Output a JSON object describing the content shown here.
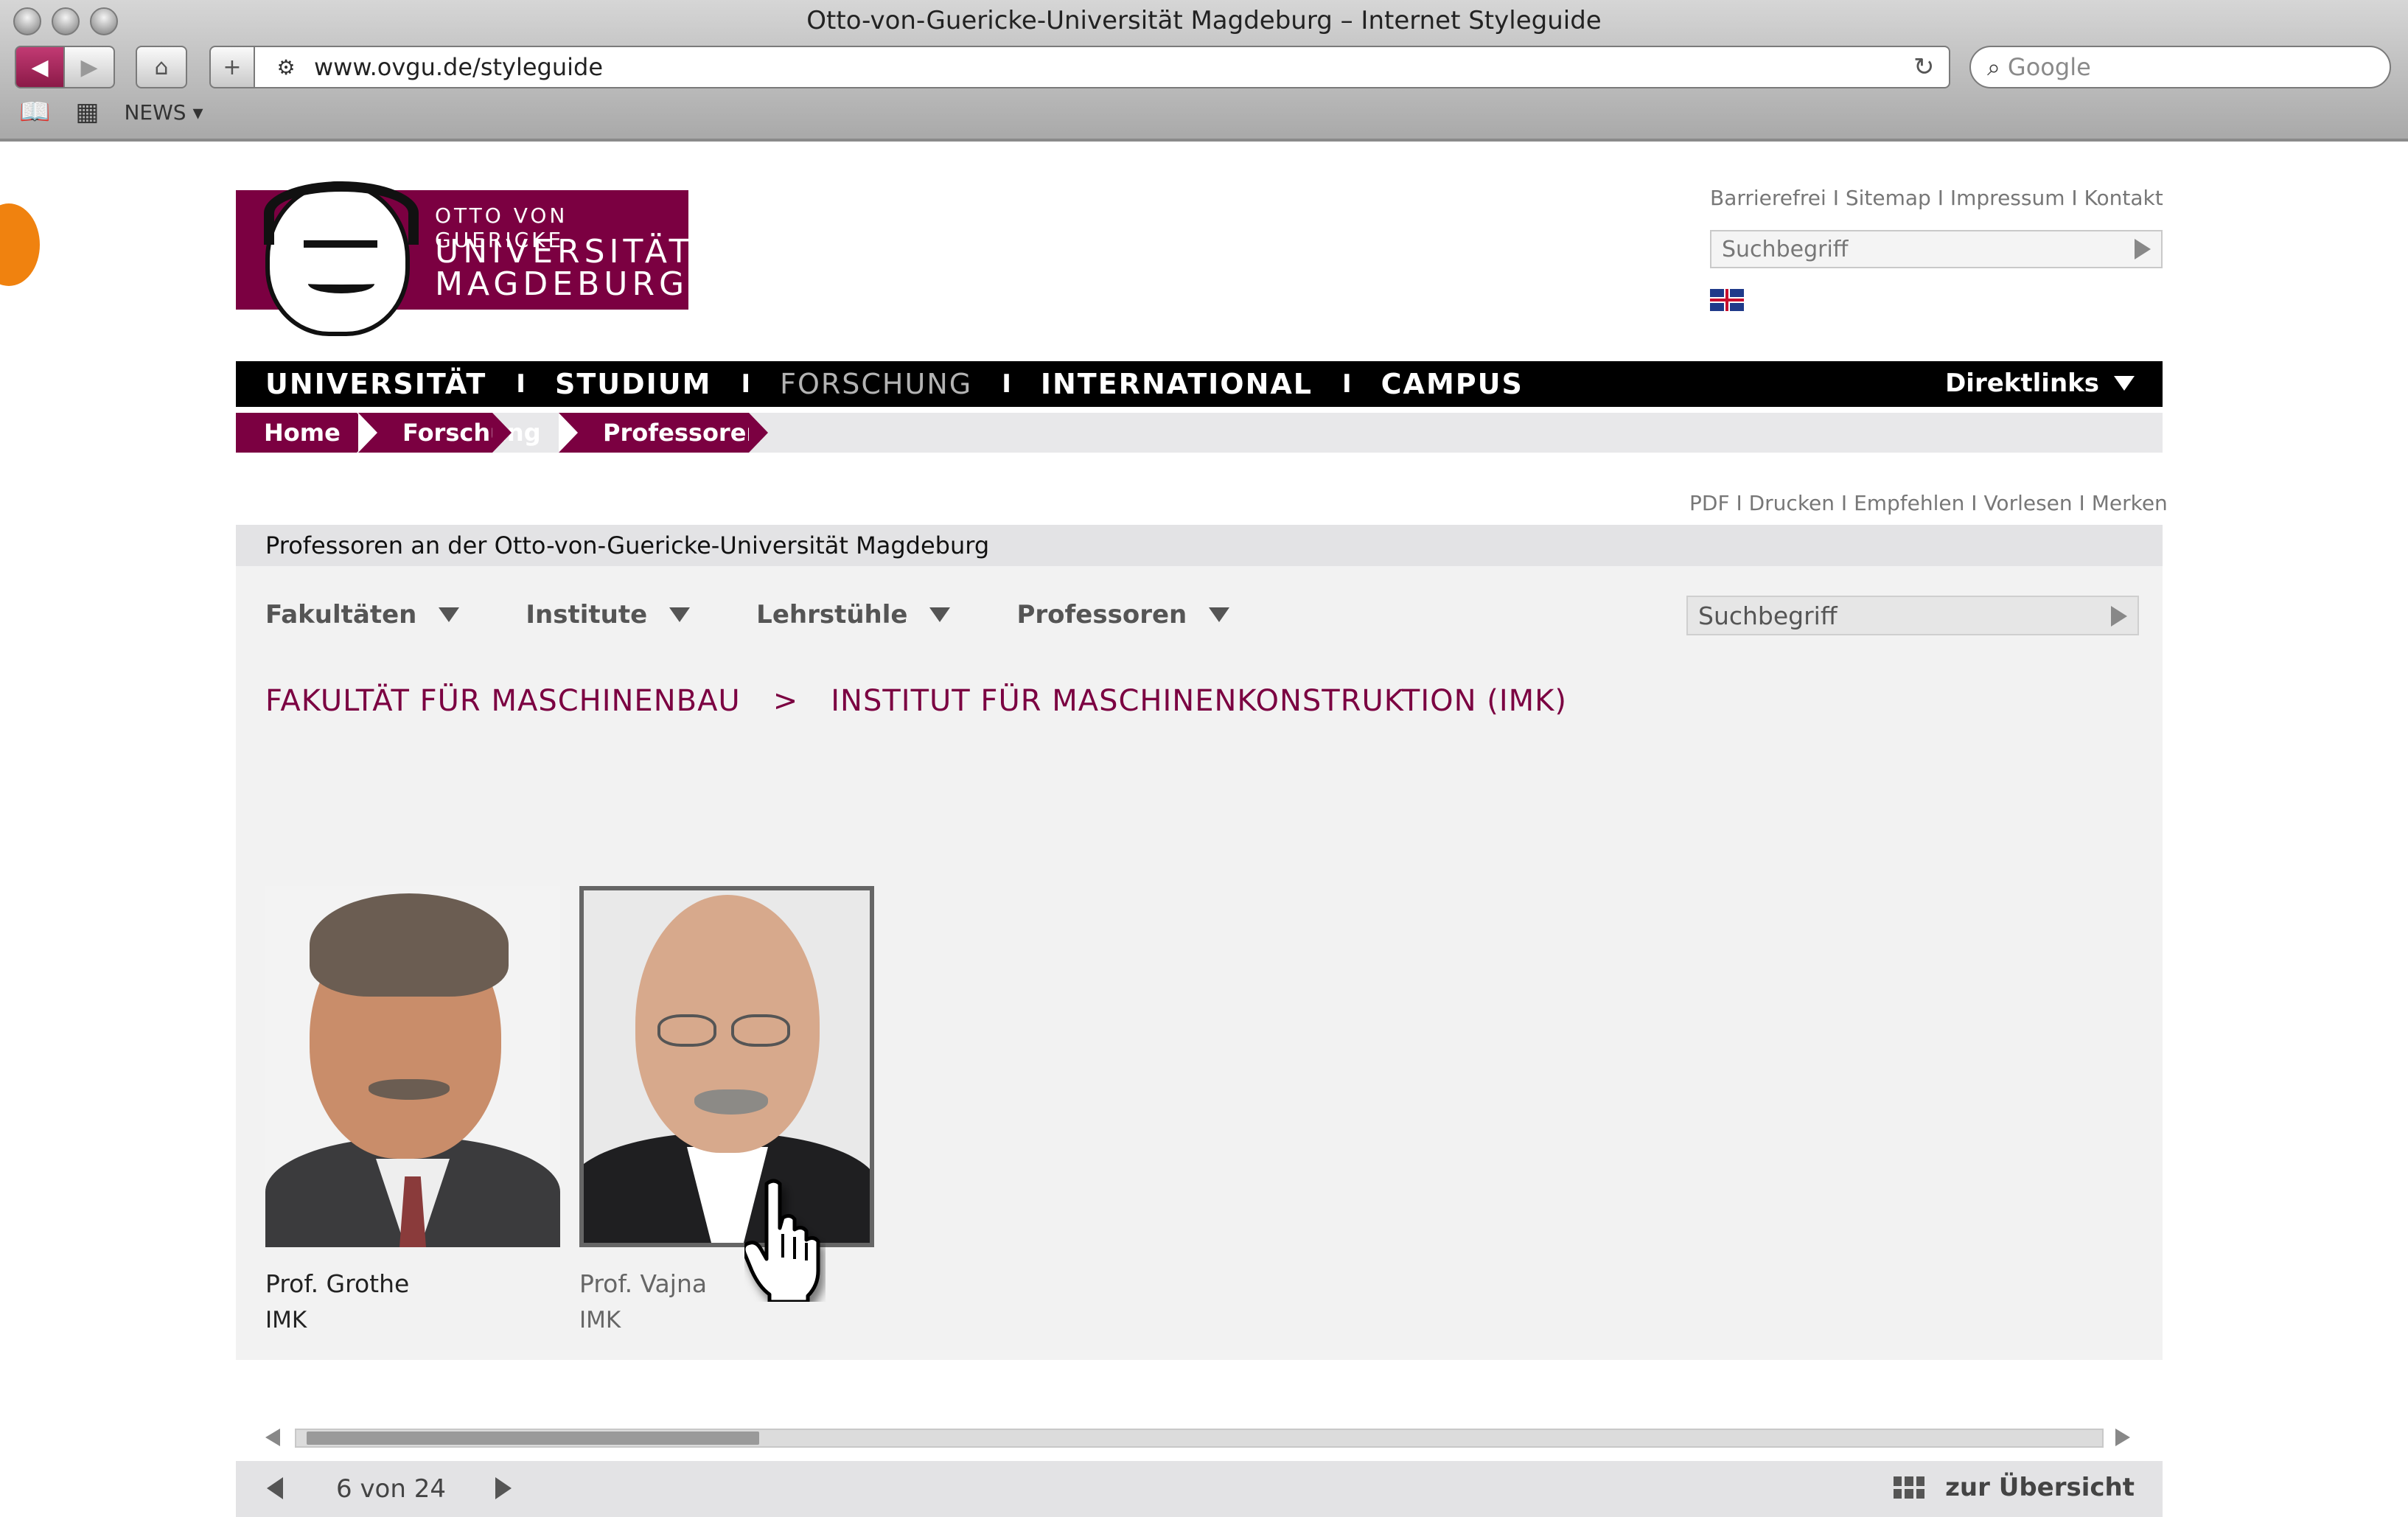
{
  "browser": {
    "window_title": "Otto-von-Guericke-Universität Magdeburg – Internet Styleguide",
    "url": "www.ovgu.de/styleguide",
    "search_placeholder": "Google",
    "bookmarks": {
      "news_label": "NEWS ▾"
    }
  },
  "logo": {
    "line1": "OTTO VON GUERICKE",
    "line2": "UNIVERSITÄT",
    "line3": "MAGDEBURG",
    "color": "#7b0041"
  },
  "header": {
    "meta_links": "Barrierefrei I Sitemap I Impressum I Kontakt",
    "search_placeholder": "Suchbegriff",
    "language_icon": "uk-flag-icon"
  },
  "main_nav": {
    "items": [
      "UNIVERSITÄT",
      "STUDIUM",
      "FORSCHUNG",
      "INTERNATIONAL",
      "CAMPUS"
    ],
    "separator": "I",
    "active": "FORSCHUNG",
    "direktlinks": "Direktlinks"
  },
  "breadcrumb": [
    "Home",
    "Forschung",
    "Professoren"
  ],
  "util_links": "PDF I Drucken I Empfehlen I Vorlesen I Merken",
  "content": {
    "title": "Professoren an der Otto-von-Guericke-Universität Magdeburg",
    "filters": [
      "Fakultäten",
      "Institute",
      "Lehrstühle",
      "Professoren"
    ],
    "search_placeholder": "Suchbegriff",
    "path": {
      "faculty": "FAKULTÄT FÜR MASCHINENBAU",
      "separator": ">",
      "institute": "INSTITUT FÜR MASCHINENKONSTRUKTION (IMK)"
    },
    "professors": [
      {
        "name": "Prof. Grothe",
        "institute": "IMK",
        "selected": false
      },
      {
        "name": "Prof. Vajna",
        "institute": "IMK",
        "selected": true
      }
    ],
    "scroll_position": 0.08,
    "pager": {
      "count": "6 von 24",
      "overview": "zur Übersicht"
    }
  }
}
